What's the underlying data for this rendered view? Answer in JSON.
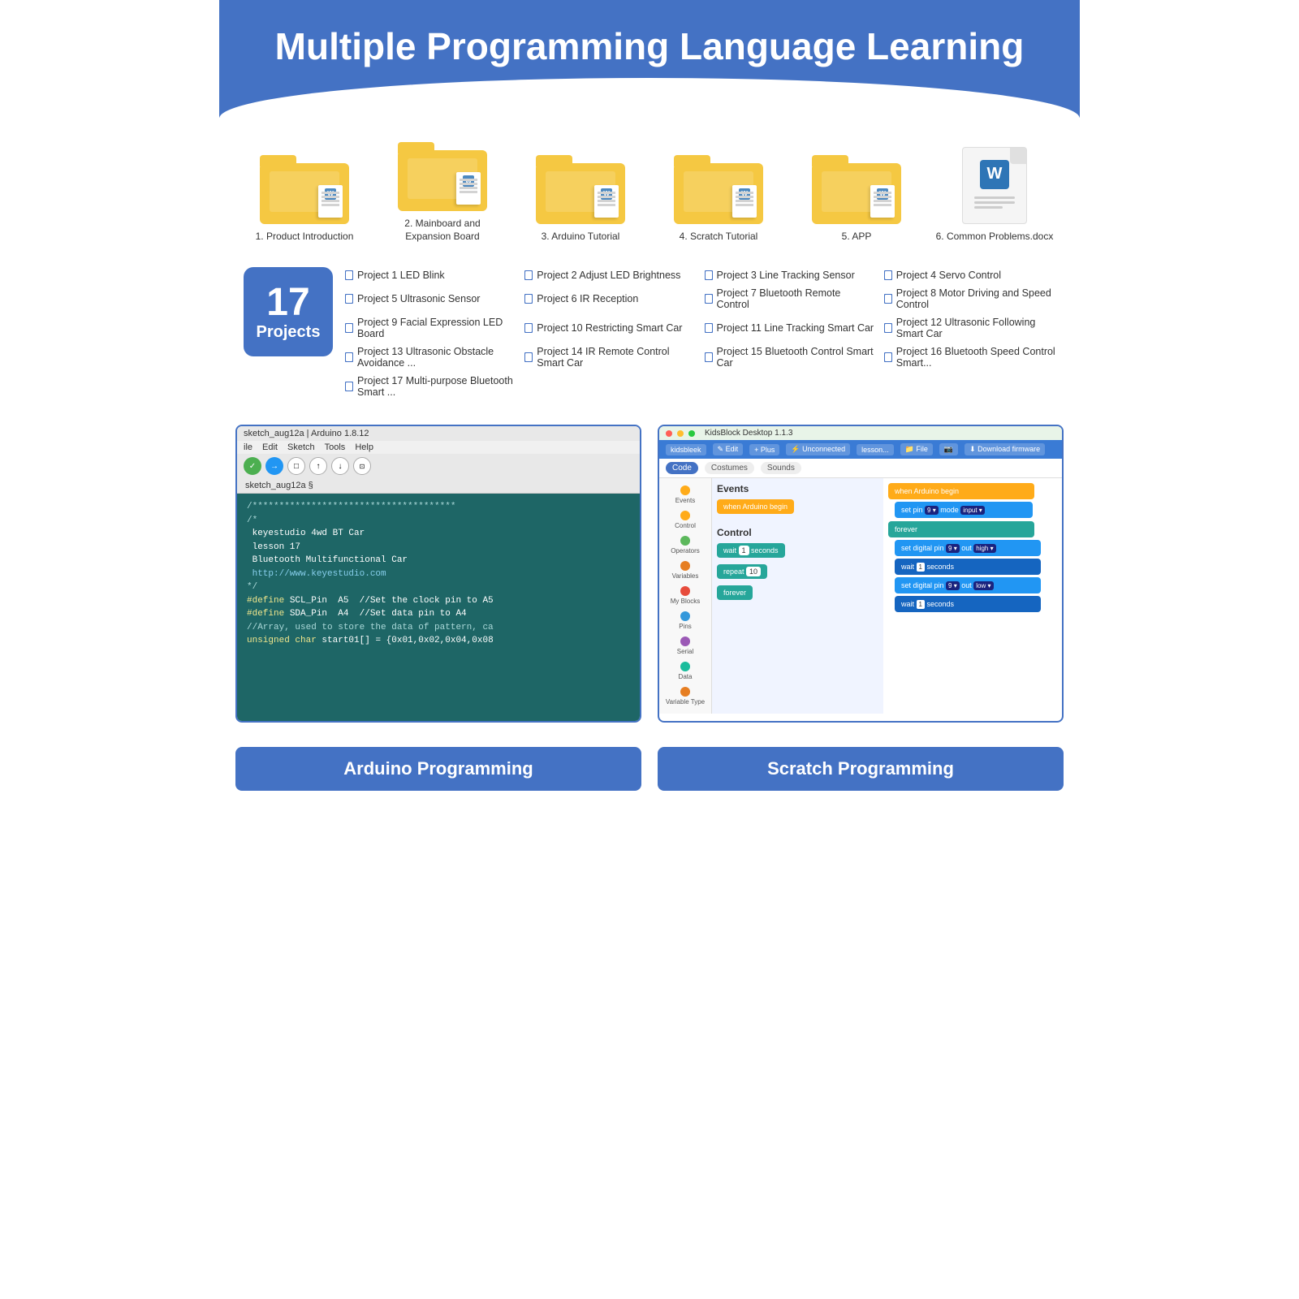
{
  "header": {
    "title": "Multiple Programming Language Learning"
  },
  "folders": [
    {
      "id": "folder-1",
      "label": "1. Product Introduction",
      "type": "folder"
    },
    {
      "id": "folder-2",
      "label": "2. Mainboard and Expansion Board",
      "type": "folder"
    },
    {
      "id": "folder-3",
      "label": "3. Arduino Tutorial",
      "type": "folder"
    },
    {
      "id": "folder-4",
      "label": "4. Scratch Tutorial",
      "type": "folder"
    },
    {
      "id": "folder-5",
      "label": "5. APP",
      "type": "folder"
    },
    {
      "id": "folder-6",
      "label": "6. Common Problems.docx",
      "type": "doc"
    }
  ],
  "projects_badge": {
    "number": "17",
    "label": "Projects"
  },
  "projects": [
    "Project 1 LED Blink",
    "Project 2 Adjust LED Brightness",
    "Project 3 Line Tracking Sensor",
    "Project 4 Servo Control",
    "Project 5 Ultrasonic Sensor",
    "Project 6 IR Reception",
    "Project 7 Bluetooth Remote Control",
    "Project 8 Motor Driving and Speed Control",
    "Project 9 Facial Expression LED Board",
    "Project 10 Restricting Smart Car",
    "Project 11 Line Tracking Smart Car",
    "Project 12 Ultrasonic Following Smart Car",
    "Project 13 Ultrasonic Obstacle Avoidance ...",
    "Project 14 IR Remote Control Smart Car",
    "Project 15 Bluetooth Control Smart Car",
    "Project 16 Bluetooth Speed Control Smart...",
    "Project 17 Multi-purpose Bluetooth Smart ..."
  ],
  "arduino": {
    "title": "sketch_aug12a | Arduino 1.8.12",
    "menu": [
      "ile",
      "Edit",
      "Sketch",
      "Tools",
      "Help"
    ],
    "filename": "sketch_aug12a §",
    "code_lines": [
      "/*************************************",
      "/*",
      " keyestudio 4wd BT Car",
      " lesson 17",
      " Bluetooth Multifunctional Car",
      " http://www.keyestudio.com",
      "*/",
      "#define SCL_Pin  A5  //Set the clock pin to A5",
      "#define SDA_Pin  A4  //Set data pin to A4",
      "//Array, used to store the data of pattern, ca",
      "unsigned char start01[] = {0x01,0x02,0x04,0x08"
    ]
  },
  "kidsblock": {
    "title": "KidsBlock Desktop 1.1.3",
    "nav_items": [
      "kidsbleek",
      "Edit",
      "Plus",
      "Unconnected",
      "lesson...",
      "File",
      "Download firmware"
    ],
    "tabs": [
      "Code",
      "Costumes",
      "Sounds"
    ],
    "sidebar_items": [
      "Events",
      "Control",
      "Operators",
      "Variables",
      "My Blocks",
      "Pins",
      "Serial",
      "Data",
      "Variable Type"
    ],
    "center_category": "Events",
    "center_blocks": [
      "when Arduino begin"
    ],
    "control_category": "Control",
    "control_blocks": [
      "wait 1 seconds",
      "repeat 10",
      "forever"
    ],
    "script_blocks": [
      "when Arduino begin",
      "set pin  9  mode  input",
      "forever",
      "set digital pin  9  out  high",
      "wait  1  seconds",
      "set digital pin  9  out  low",
      "wait  1  seconds"
    ]
  },
  "bottom_labels": {
    "arduino": "Arduino Programming",
    "scratch": "Scratch Programming"
  }
}
